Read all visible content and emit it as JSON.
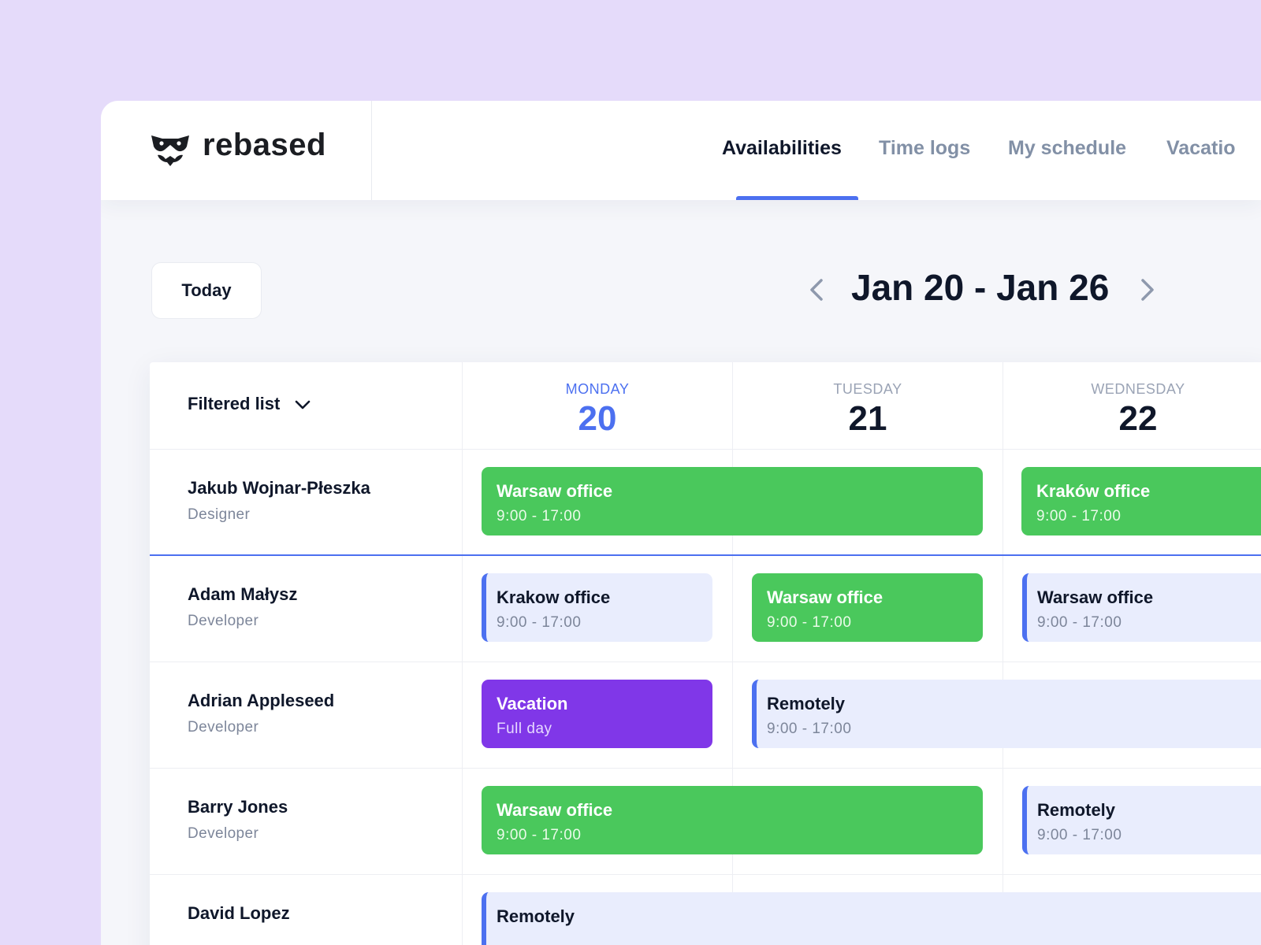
{
  "brand": {
    "name": "rebased",
    "logo_icon": "raccoon-mask-icon"
  },
  "nav": {
    "tabs": [
      {
        "label": "Availabilities",
        "active": true
      },
      {
        "label": "Time logs",
        "active": false
      },
      {
        "label": "My schedule",
        "active": false
      },
      {
        "label": "Vacatio",
        "active": false
      }
    ]
  },
  "toolbar": {
    "today_label": "Today",
    "week_range": "Jan 20 - Jan 26",
    "prev_icon": "chevron-left-icon",
    "next_icon": "chevron-right-icon"
  },
  "grid": {
    "filter_label": "Filtered list",
    "days": [
      {
        "name": "MONDAY",
        "number": "20",
        "current": true
      },
      {
        "name": "TUESDAY",
        "number": "21",
        "current": false
      },
      {
        "name": "WEDNESDAY",
        "number": "22",
        "current": false
      }
    ],
    "people": [
      {
        "name": "Jakub Wojnar-Płeszka",
        "role": "Designer",
        "events": [
          {
            "title": "Warsaw office",
            "time": "9:00 - 17:00",
            "style": "green"
          },
          {
            "title": "Kraków office",
            "time": "9:00 - 17:00",
            "style": "green"
          }
        ]
      },
      {
        "name": "Adam Małysz",
        "role": "Developer",
        "events": [
          {
            "title": "Krakow office",
            "time": "9:00 - 17:00",
            "style": "light"
          },
          {
            "title": "Warsaw office",
            "time": "9:00 - 17:00",
            "style": "green"
          },
          {
            "title": "Warsaw office",
            "time": "9:00 - 17:00",
            "style": "light"
          }
        ]
      },
      {
        "name": "Adrian Appleseed",
        "role": "Developer",
        "events": [
          {
            "title": "Vacation",
            "time": "Full day",
            "style": "purple"
          },
          {
            "title": "Remotely",
            "time": "9:00 - 17:00",
            "style": "light"
          }
        ]
      },
      {
        "name": "Barry Jones",
        "role": "Developer",
        "events": [
          {
            "title": "Warsaw office",
            "time": "9:00 - 17:00",
            "style": "green"
          },
          {
            "title": "Remotely",
            "time": "9:00 - 17:00",
            "style": "light"
          }
        ]
      },
      {
        "name": "David Lopez",
        "role": "",
        "events": [
          {
            "title": "Remotely",
            "time": "",
            "style": "light"
          }
        ]
      }
    ]
  },
  "colors": {
    "background": "#e5dbfa",
    "accent": "#4c70f0",
    "office_green": "#4ac85c",
    "vacation_purple": "#8037e8",
    "remote_light": "#e9edfd"
  }
}
